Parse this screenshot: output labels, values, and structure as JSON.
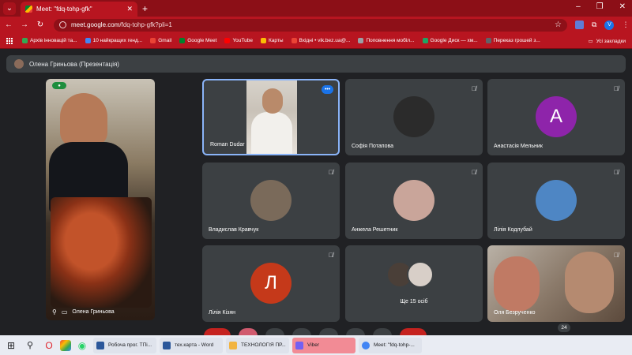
{
  "browser": {
    "tab_title": "Meet: \"fdq-tohp-gfk\"",
    "new_tab": "+",
    "url_host": "meet.google.com",
    "url_path": "/fdq-tohp-gfk?pli=1",
    "window_controls": [
      "–",
      "❐",
      "✕"
    ]
  },
  "bookmarks": {
    "items": [
      {
        "label": "Архів інновацій та...",
        "color": "#34a853"
      },
      {
        "label": "10 найкращих генд...",
        "color": "#4285f4"
      },
      {
        "label": "Gmail",
        "color": "#ea4335"
      },
      {
        "label": "Google Meet",
        "color": "#00832d"
      },
      {
        "label": "YouTube",
        "color": "#ff0000"
      },
      {
        "label": "Карты",
        "color": "#fbbc04"
      },
      {
        "label": "Вхідні • vik.bez.ua@...",
        "color": "#ea4335"
      },
      {
        "label": "Поповнення мобіл...",
        "color": "#9aa0a6"
      },
      {
        "label": "Google Диск — хм...",
        "color": "#1fa463"
      },
      {
        "label": "Переказ грошей з...",
        "color": "#5f6368"
      }
    ],
    "all_bookmarks": "Усі закладки"
  },
  "meet": {
    "presenter_label": "Олена Гриньова (Презентація)",
    "self_name": "Олена Гриньова",
    "self_badge": "●",
    "participants": [
      {
        "name": "Roman Dudar",
        "type": "video",
        "active": true
      },
      {
        "name": "Софія Потапова",
        "type": "avatar",
        "color": "#2b2b2b",
        "initial": ""
      },
      {
        "name": "Анастасія Мельник",
        "type": "avatar",
        "color": "#8e24aa",
        "initial": "A"
      },
      {
        "name": "Владислав Кравчук",
        "type": "avatar",
        "color": "#7a6a5a",
        "initial": ""
      },
      {
        "name": "Анжела Решетник",
        "type": "avatar",
        "color": "#c9a59a",
        "initial": ""
      },
      {
        "name": "Лілія Кодлубай",
        "type": "avatar",
        "color": "#4e86c4",
        "initial": ""
      },
      {
        "name": "Лілія Кізян",
        "type": "avatar",
        "color": "#c5391a",
        "initial": "Л"
      },
      {
        "name": "Ще 15 осіб",
        "type": "group"
      },
      {
        "name": "Оля Безрученко",
        "type": "photo"
      }
    ],
    "participant_count": "24"
  },
  "taskbar": {
    "apps": [
      {
        "label": "Робоча прог. ТПі...",
        "color": "#2b579a"
      },
      {
        "label": "тех.карта - Word",
        "color": "#2b579a"
      },
      {
        "label": "ТЕХНОЛОГІЯ ПР...",
        "color": "#f2b441"
      },
      {
        "label": "Viber",
        "color": "#7360f2"
      },
      {
        "label": "Meet: \"fdq-tohp-...",
        "color": "#4285f4"
      }
    ]
  }
}
